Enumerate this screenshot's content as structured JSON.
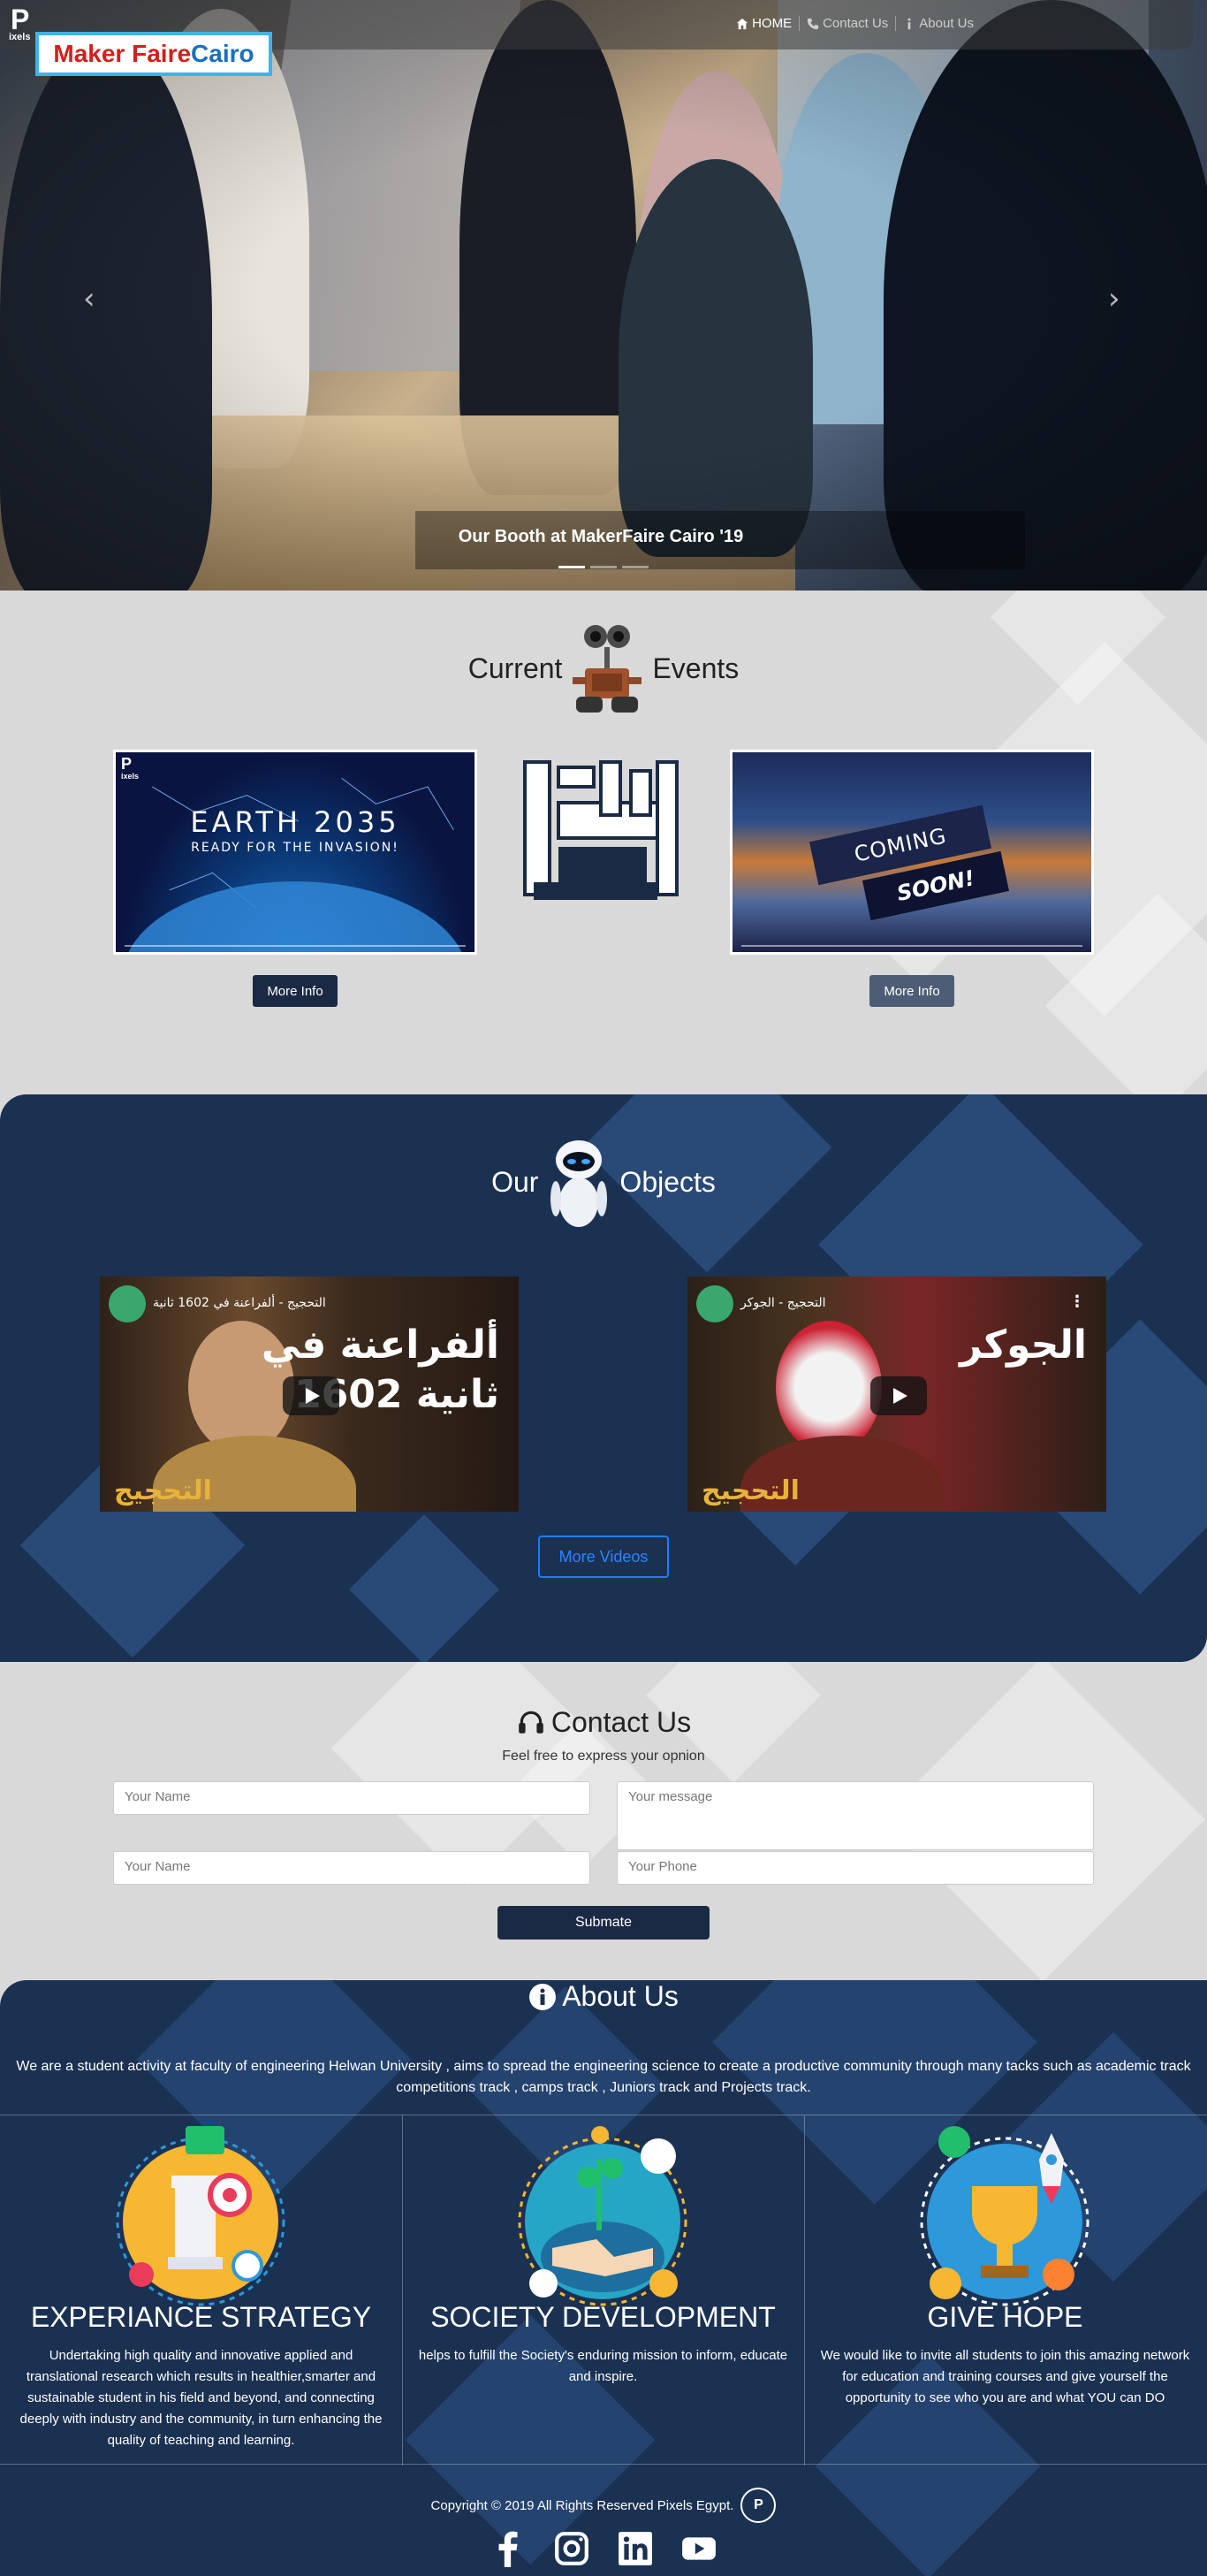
{
  "nav": {
    "logo_letter": "P",
    "logo_text": "ixels",
    "links": [
      {
        "label": "HOME",
        "icon": "home-icon"
      },
      {
        "label": "Contact Us",
        "icon": "phone-icon"
      },
      {
        "label": "About Us",
        "icon": "info-icon"
      }
    ]
  },
  "hero": {
    "badge_part1": "Maker Faire ",
    "badge_part2": "Cairo",
    "caption": "Our Booth at MakerFaire Cairo '19",
    "prev_glyph": "‹",
    "next_glyph": "›",
    "active_slide": 0,
    "slide_count": 3
  },
  "events": {
    "title_left": "Current",
    "title_right": "Events",
    "card1": {
      "title": "EARTH 2035",
      "subtitle": "READY FOR THE INVASION!",
      "logo_letter": "P",
      "logo_text": "ixels"
    },
    "card3": {
      "line1": "COMING",
      "line2": "SOON!"
    },
    "more_info": "More Info"
  },
  "objects": {
    "title_left": "Our",
    "title_right": "Objects",
    "videos": [
      {
        "title": "التحجيج - ألفراعنة في 1602 ثانية",
        "overlay_l1": "ألفراعنة في",
        "overlay_l2": "1602 ثانية",
        "brand": "التحجيج"
      },
      {
        "title": "التحجيج - الجوكر",
        "overlay_l1": "الجوكر",
        "overlay_l2": "",
        "brand": "التحجيج"
      }
    ],
    "more_videos": "More Videos"
  },
  "contact": {
    "title": "Contact Us",
    "subtitle": "Feel free to express your opnion",
    "name_placeholder": "Your Name",
    "message_placeholder": "Your message",
    "name2_placeholder": "Your Name",
    "phone_placeholder": "Your Phone",
    "submit": "Submate"
  },
  "about": {
    "title": "About Us",
    "description": "We are a student activity at faculty of engineering Helwan University , aims to spread the engineering science to create a productive community through many tacks such as academic track competitions track , camps track , Juniors track and Projects track.",
    "columns": [
      {
        "title": "EXPERIANCE STRATEGY",
        "text": "Undertaking high quality and innovative applied and translational research which results in healthier,smarter and sustainable student in his field and beyond, and connecting deeply with industry and the community, in turn enhancing the quality of teaching and learning."
      },
      {
        "title": "SOCIETY DEVELOPMENT",
        "text": "helps to fulfill the Society's enduring mission to inform, educate and inspire."
      },
      {
        "title": "GIVE HOPE",
        "text": "We would like to invite all students to join this amazing network for education and training courses and give yourself the opportunity to see who you are and what YOU can DO"
      }
    ]
  },
  "footer": {
    "copyright": "Copyright © 2019 All Rights Reserved Pixels Egypt.",
    "mini_logo": "P",
    "socials": [
      "facebook-icon",
      "instagram-icon",
      "linkedin-icon",
      "youtube-icon"
    ]
  },
  "colors": {
    "navy": "#1b3152",
    "button": "#1b2a44",
    "link_blue": "#1e7dff",
    "badge_red": "#d0211c",
    "badge_blue": "#1b6fc0"
  }
}
